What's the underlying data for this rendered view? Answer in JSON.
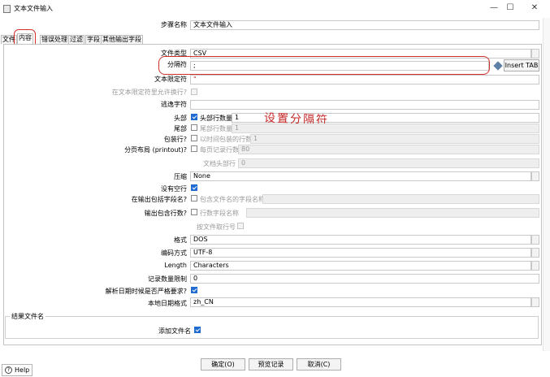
{
  "window": {
    "title": "文本文件输入",
    "minimize": "—",
    "maximize": "☐",
    "close": "✕"
  },
  "step": {
    "label": "步骤名称",
    "value": "文本文件输入"
  },
  "tabs": [
    {
      "label": "文件"
    },
    {
      "label": "内容"
    },
    {
      "label": "错误处理"
    },
    {
      "label": "过滤"
    },
    {
      "label": "字段"
    },
    {
      "label": "其他输出字段"
    }
  ],
  "content": {
    "file_type": {
      "label": "文件类型",
      "value": "CSV"
    },
    "separator": {
      "label": "分隔符",
      "value": ";",
      "insert_tab": "Insert TAB"
    },
    "enclosure": {
      "label": "文本限定符",
      "value": "\""
    },
    "escape_break": {
      "label": "在文本限定符里允许换行?"
    },
    "escape": {
      "label": "逃逸字符",
      "value": ""
    },
    "header": {
      "label": "头部",
      "rows_label": "头部行数量",
      "rows_value": "1"
    },
    "footer": {
      "label": "尾部",
      "rows_label": "尾部行数量",
      "rows_value": "1"
    },
    "wrapped": {
      "label": "包装行?",
      "rows_label": "以时间包装的行数",
      "rows_value": "1"
    },
    "paged": {
      "label": "分页布局 (printout)?",
      "rows_label": "每页记录行数",
      "rows_value": "80"
    },
    "doc_header": {
      "label": "文档头部行",
      "value": "0"
    },
    "compression": {
      "label": "压缩",
      "value": "None"
    },
    "no_empty": {
      "label": "没有空行"
    },
    "include_filename": {
      "label": "在输出包括字段名?",
      "cb_label": "包含文件名的字段名称"
    },
    "include_rownum": {
      "label": "输出包含行数?",
      "cb_label": "行数字段名称"
    },
    "rownum_by_file": {
      "label": "按文件取行号"
    },
    "format": {
      "label": "格式",
      "value": "DOS"
    },
    "encoding": {
      "label": "编码方式",
      "value": "UTF-8"
    },
    "length": {
      "label": "Length",
      "value": "Characters"
    },
    "limit": {
      "label": "记录数量限制",
      "value": "0"
    },
    "lenient_date": {
      "label": "解析日期时候是否严格要求?"
    },
    "locale": {
      "label": "本地日期格式",
      "value": "zh_CN"
    }
  },
  "result_group": {
    "title": "结果文件名",
    "add_filename": "添加文件名"
  },
  "annotation": "设置分隔符",
  "buttons": {
    "ok": "确定(O)",
    "preview": "预览记录",
    "cancel": "取消(C)",
    "help": "Help"
  },
  "colors": {
    "accent": "#1f6bd1",
    "annotation": "#d32f2f"
  },
  "icons": {
    "insert_tab": "diamond-icon",
    "help": "question-circle-icon",
    "app": "document-icon"
  }
}
